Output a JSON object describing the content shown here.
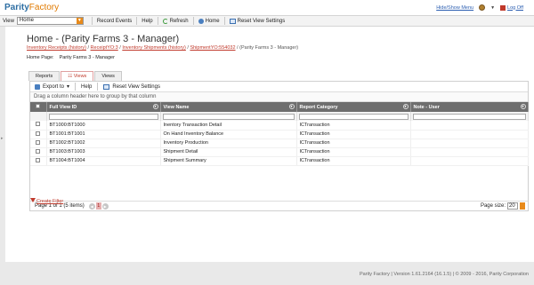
{
  "header": {
    "logo_parity": "Parity",
    "logo_factory": "Factory",
    "hide_show_menu": "Hide/Show Menu",
    "logout": "Log Off"
  },
  "toolbar": {
    "view_label": "View",
    "view_value": "Home",
    "record_events": "Record Events",
    "help": "Help",
    "refresh": "Refresh",
    "home": "Home",
    "reset_view_settings": "Reset View Settings"
  },
  "page": {
    "title": "Home - (Parity Farms 3 - Manager)",
    "breadcrumbs": [
      "Inventory Receipts (history)",
      "ReceiptYO:3",
      "Inventory Shipments (history)",
      "ShipmentYO:554032"
    ],
    "breadcrumb_tail": "(Parity Farms 3 - Manager)",
    "home_page_label": "Home Page:",
    "home_page_value": "Parity Farms 3 - Manager"
  },
  "tabs": [
    {
      "label": "Reports",
      "active": false
    },
    {
      "label": "Views",
      "active": true
    },
    {
      "label": "Views",
      "active": false
    }
  ],
  "grid": {
    "export_to": "Export to",
    "help": "Help",
    "reset_view_settings": "Reset View Settings",
    "group_hint": "Drag a column header here to group by that column",
    "columns": [
      "Full View ID",
      "View Name",
      "Report Category",
      "Note - User"
    ],
    "rows": [
      {
        "id": "BT1000:BT1000",
        "name": "Inentory Transaction Detail",
        "category": "ICTransaction",
        "note": ""
      },
      {
        "id": "BT1001:BT1001",
        "name": "On Hand Inventory Balance",
        "category": "ICTransaction",
        "note": ""
      },
      {
        "id": "BT1002:BT1002",
        "name": "Inventory Production",
        "category": "ICTransaction",
        "note": ""
      },
      {
        "id": "BT1003:BT1003",
        "name": "Shipment Detail",
        "category": "ICTransaction",
        "note": ""
      },
      {
        "id": "BT1004:BT1004",
        "name": "Shipment Summary",
        "category": "ICTransaction",
        "note": ""
      }
    ],
    "pager_text": "Page 1 of 1 (5 items)",
    "current_page": "1",
    "page_size_label": "Page size:",
    "page_size_value": "20"
  },
  "create_filter": "Create Filter",
  "footer": "Parity Factory | Version 1.61.2164 (16.1.5) | © 2009 - 2016, Parity Corporation"
}
